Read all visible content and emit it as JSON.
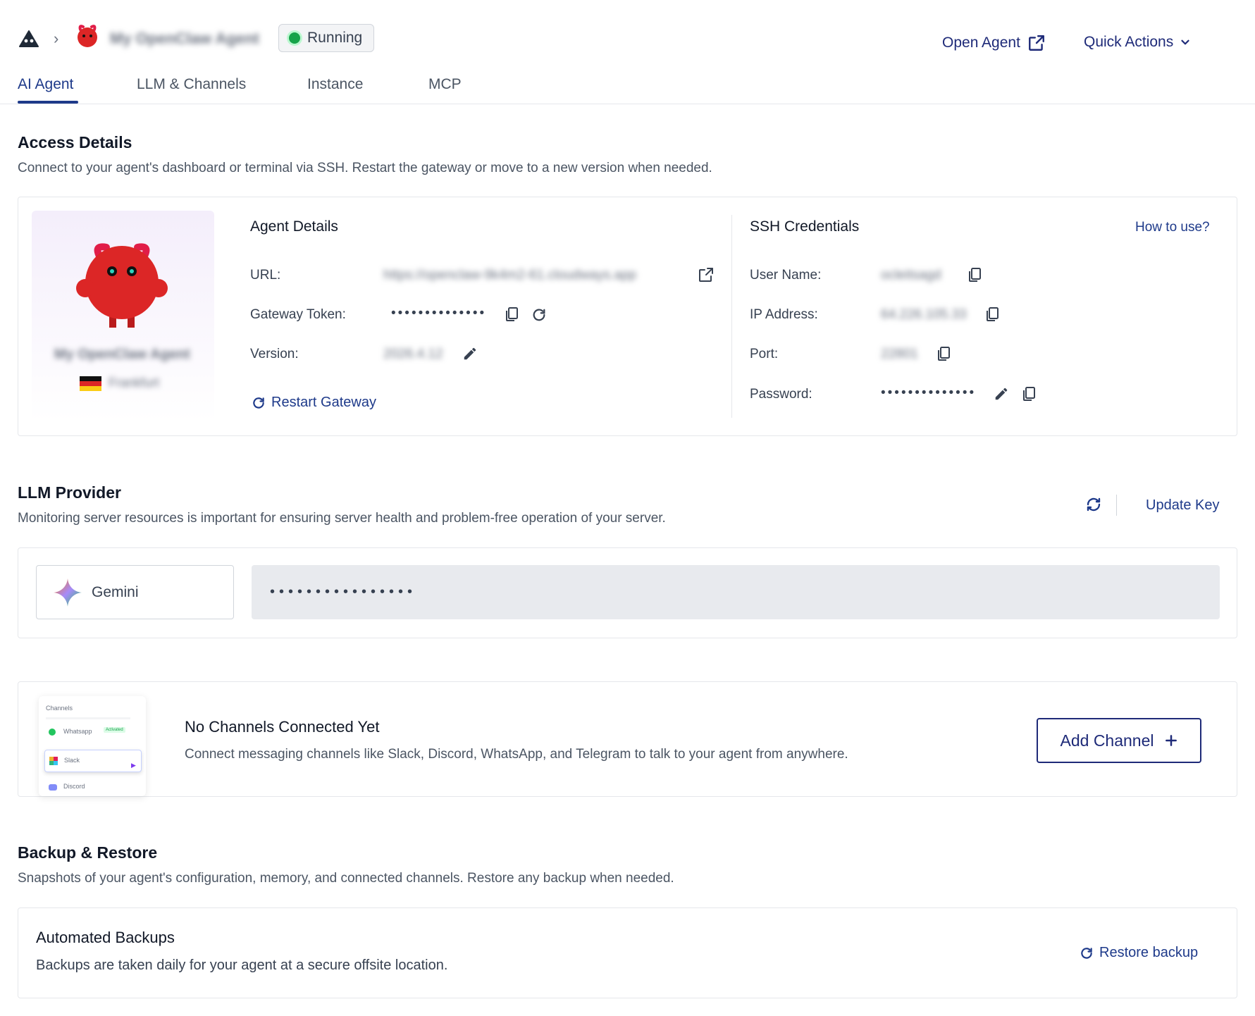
{
  "header": {
    "breadcrumb_logo_icon": "agent-logo-icon",
    "agent_name": "My OpenClaw Agent",
    "status": "Running",
    "status_color": "#16a34a",
    "open_agent_label": "Open Agent",
    "quick_actions_label": "Quick Actions"
  },
  "tabs": [
    {
      "label": "AI Agent",
      "active": true
    },
    {
      "label": "LLM & Channels",
      "active": false
    },
    {
      "label": "Instance",
      "active": false
    },
    {
      "label": "MCP",
      "active": false
    }
  ],
  "access": {
    "title": "Access Details",
    "subtitle": "Connect to your agent's dashboard or terminal via SSH. Restart the gateway or move to a new version when needed.",
    "tile": {
      "agent_name": "My OpenClaw Agent",
      "location": "Frankfurt",
      "flag": "germany-flag-icon"
    },
    "agent_details": {
      "title": "Agent Details",
      "url_label": "URL:",
      "url_value": "https://openclaw-9k4m2-61.cloudways.app",
      "token_label": "Gateway Token:",
      "token_value": "••••••••••••••",
      "version_label": "Version:",
      "version_value": "2026.4.12",
      "restart_label": "Restart Gateway"
    },
    "ssh": {
      "title": "SSH Credentials",
      "how_to_use": "How to use?",
      "username_label": "User Name:",
      "username_value": "ocleitsagd",
      "ip_label": "IP Address:",
      "ip_value": "64.226.105.33",
      "port_label": "Port:",
      "port_value": "22801",
      "password_label": "Password:",
      "password_value": "••••••••••••••"
    }
  },
  "llm": {
    "title": "LLM Provider",
    "subtitle": "Monitoring server resources is important for ensuring server health and problem-free operation of your server.",
    "update_key_label": "Update Key",
    "provider": "Gemini",
    "key_masked": "••••••••••••••••"
  },
  "channels": {
    "title": "No Channels Connected Yet",
    "subtitle": "Connect messaging channels like Slack, Discord, WhatsApp, and Telegram to talk to your agent from anywhere.",
    "add_label": "Add Channel",
    "preview": {
      "heading": "Channels",
      "items": [
        "Whatsapp",
        "Slack",
        "Discord"
      ],
      "badge": "Activated"
    }
  },
  "backup": {
    "title": "Backup & Restore",
    "subtitle": "Snapshots of your agent's configuration, memory, and connected channels. Restore any backup when needed.",
    "card_title": "Automated Backups",
    "card_text": "Backups are taken daily for your agent at a secure offsite location.",
    "restore_label": "Restore backup"
  },
  "colors": {
    "accent": "#1e3a8a",
    "link": "#1e2a78",
    "border": "#e5e7eb",
    "mascot": "#dc2626"
  }
}
